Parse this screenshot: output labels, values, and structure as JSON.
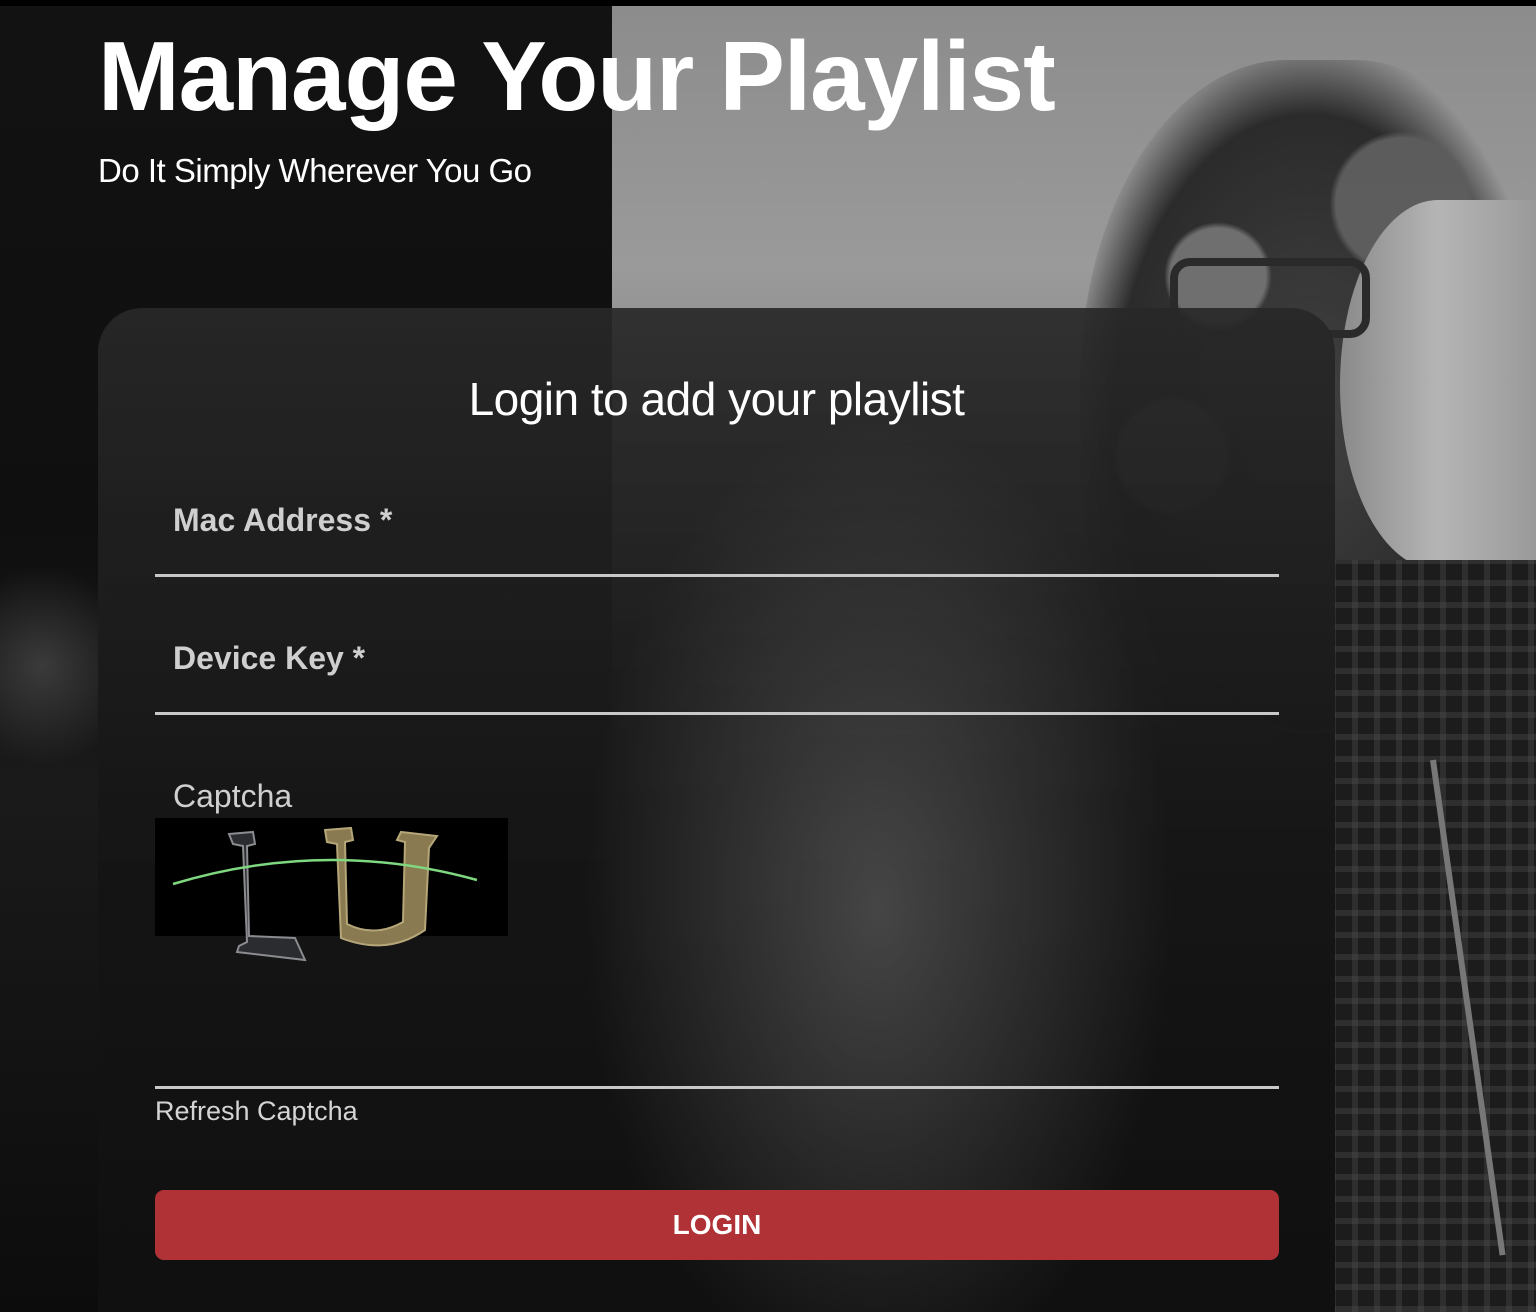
{
  "hero": {
    "title": "Manage Your Playlist",
    "subtitle": "Do It Simply Wherever You Go"
  },
  "login_form": {
    "title": "Login to add your playlist",
    "mac_address_label": "Mac Address *",
    "device_key_label": "Device Key *",
    "captcha_label": "Captcha",
    "captcha_image_text": "LU",
    "refresh_captcha": "Refresh Captcha",
    "login_button": "LOGIN"
  },
  "colors": {
    "accent": "#b03236",
    "background": "#0d0d0d",
    "text": "#ffffff",
    "field_line": "#c8c8c8"
  }
}
